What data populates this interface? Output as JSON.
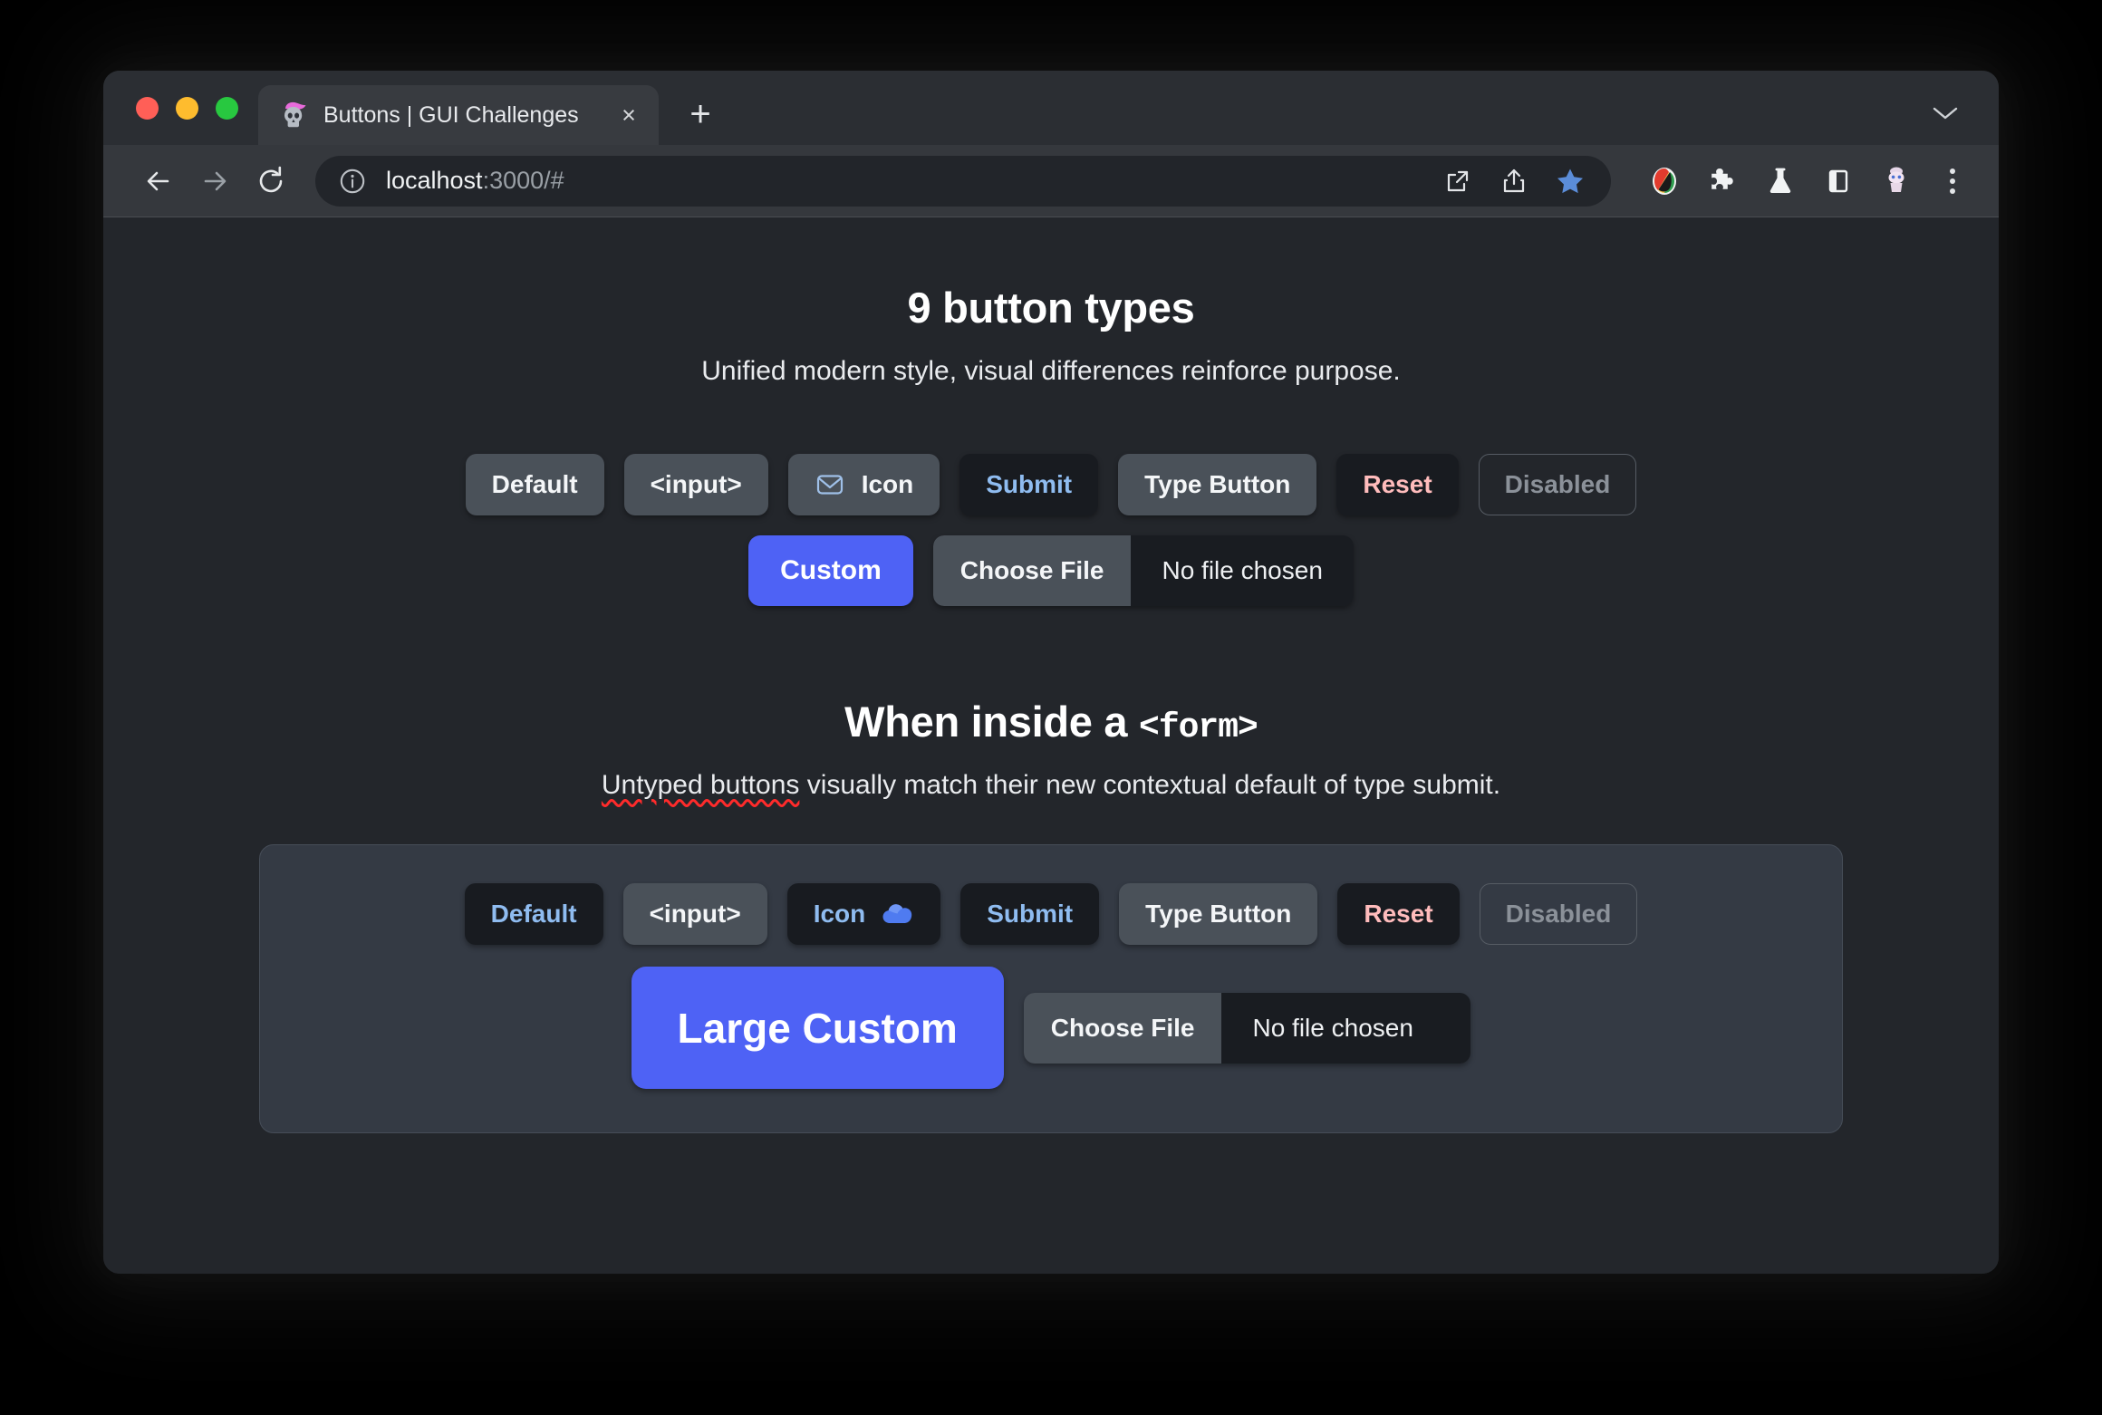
{
  "browser": {
    "tab": {
      "title": "Buttons | GUI Challenges",
      "favicon_name": "skull-with-pink-cap-favicon",
      "close_label": "×"
    },
    "new_tab_label": "+",
    "window_chevron_label": "⌄",
    "toolbar": {
      "back_name": "back-button",
      "forward_name": "forward-button",
      "reload_name": "reload-button",
      "url_host": "localhost",
      "url_rest": ":3000/#",
      "site_info_icon": "info-circle-icon",
      "open_in_new_icon": "open-in-new-icon",
      "share_icon": "share-icon",
      "bookmark_icon": "star-icon",
      "extensions": [
        "color-palette-extension-icon",
        "puzzle-piece-extensions-icon",
        "flask-labs-icon",
        "side-panel-icon",
        "profile-avatar-icon"
      ],
      "menu_icon": "three-dot-menu-icon"
    }
  },
  "page": {
    "section_one": {
      "title": "9 button types",
      "subtitle": "Unified modern style, visual differences reinforce purpose.",
      "row_one": [
        {
          "label": "Default",
          "name": "default-button",
          "variant": "default",
          "icon": null
        },
        {
          "label": "<input>",
          "name": "input-button",
          "variant": "default",
          "icon": null
        },
        {
          "label": "Icon",
          "name": "icon-button",
          "variant": "default",
          "icon": "mail-icon"
        },
        {
          "label": "Submit",
          "name": "submit-button",
          "variant": "submit",
          "icon": null
        },
        {
          "label": "Type Button",
          "name": "type-button",
          "variant": "typebtn",
          "icon": null
        },
        {
          "label": "Reset",
          "name": "reset-button",
          "variant": "reset",
          "icon": null
        },
        {
          "label": "Disabled",
          "name": "disabled-button",
          "variant": "disabled",
          "icon": null
        }
      ],
      "custom_label": "Custom",
      "file_button_label": "Choose File",
      "file_status_label": "No file chosen"
    },
    "section_two": {
      "title_lead": "When inside a ",
      "title_mono": "<form>",
      "subtitle_spell": "Untyped buttons",
      "subtitle_rest": " visually match their new contextual default of type submit.",
      "row_one": [
        {
          "label": "Default",
          "name": "form-default-button",
          "variant": "default-sub",
          "icon": null
        },
        {
          "label": "<input>",
          "name": "form-input-button",
          "variant": "default",
          "icon": null
        },
        {
          "label": "Icon",
          "name": "form-icon-button",
          "variant": "submit-plain",
          "icon": "cloud-icon"
        },
        {
          "label": "Submit",
          "name": "form-submit-button",
          "variant": "submit",
          "icon": null
        },
        {
          "label": "Type Button",
          "name": "form-type-button",
          "variant": "typebtn",
          "icon": null
        },
        {
          "label": "Reset",
          "name": "form-reset-button",
          "variant": "reset",
          "icon": null
        },
        {
          "label": "Disabled",
          "name": "form-disabled-button",
          "variant": "disabled",
          "icon": null
        }
      ],
      "large_custom_label": "Large Custom",
      "file_button_label": "Choose File",
      "file_status_label": "No file chosen"
    }
  },
  "colors": {
    "page_bg": "#23262b",
    "accent_blue": "#4e62f5",
    "submit_text": "#8fbcf0",
    "reset_text": "#ffbcbc",
    "disabled_text": "#8b9199",
    "neutral_button": "#4a5159",
    "dark_button": "#181b20",
    "form_box_bg": "#343a44"
  }
}
